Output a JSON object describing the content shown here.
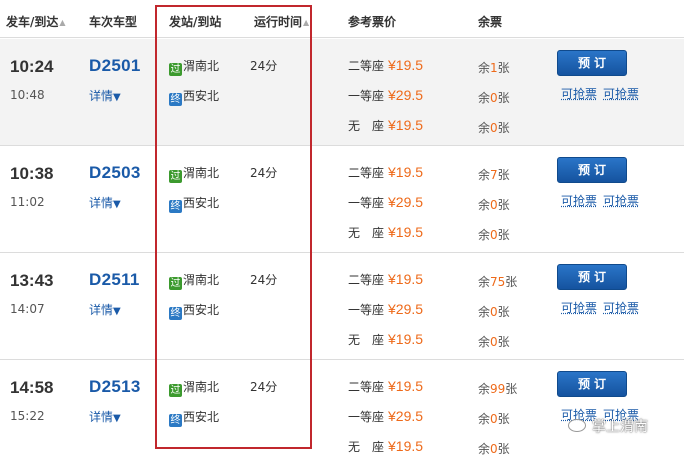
{
  "header": {
    "depart_arrive": "发车/到达",
    "train_type": "车次车型",
    "station": "发站/到站",
    "duration": "运行时间",
    "price": "参考票价",
    "remaining": "余票"
  },
  "labels": {
    "detail": "详情",
    "book": "预订",
    "grab": "可抢票",
    "pass_badge": "过",
    "end_badge": "终"
  },
  "rows": [
    {
      "depart": "10:24",
      "arrive": "10:48",
      "train": "D2501",
      "from": "渭南北",
      "to": "西安北",
      "duration": "24分",
      "seats": [
        {
          "name": "二等座",
          "price": "¥19.5",
          "remain_pre": "余",
          "remain_num": "1",
          "remain_suf": "张"
        },
        {
          "name": "一等座",
          "price": "¥29.5",
          "remain_pre": "余",
          "remain_num": "0",
          "remain_suf": "张"
        },
        {
          "name": "无　座",
          "price": "¥19.5",
          "remain_pre": "余",
          "remain_num": "0",
          "remain_suf": "张"
        }
      ]
    },
    {
      "depart": "10:38",
      "arrive": "11:02",
      "train": "D2503",
      "from": "渭南北",
      "to": "西安北",
      "duration": "24分",
      "seats": [
        {
          "name": "二等座",
          "price": "¥19.5",
          "remain_pre": "余",
          "remain_num": "7",
          "remain_suf": "张"
        },
        {
          "name": "一等座",
          "price": "¥29.5",
          "remain_pre": "余",
          "remain_num": "0",
          "remain_suf": "张"
        },
        {
          "name": "无　座",
          "price": "¥19.5",
          "remain_pre": "余",
          "remain_num": "0",
          "remain_suf": "张"
        }
      ]
    },
    {
      "depart": "13:43",
      "arrive": "14:07",
      "train": "D2511",
      "from": "渭南北",
      "to": "西安北",
      "duration": "24分",
      "seats": [
        {
          "name": "二等座",
          "price": "¥19.5",
          "remain_pre": "余",
          "remain_num": "75",
          "remain_suf": "张"
        },
        {
          "name": "一等座",
          "price": "¥29.5",
          "remain_pre": "余",
          "remain_num": "0",
          "remain_suf": "张"
        },
        {
          "name": "无　座",
          "price": "¥19.5",
          "remain_pre": "余",
          "remain_num": "0",
          "remain_suf": "张"
        }
      ]
    },
    {
      "depart": "14:58",
      "arrive": "15:22",
      "train": "D2513",
      "from": "渭南北",
      "to": "西安北",
      "duration": "24分",
      "seats": [
        {
          "name": "二等座",
          "price": "¥19.5",
          "remain_pre": "余",
          "remain_num": "99",
          "remain_suf": "张"
        },
        {
          "name": "一等座",
          "price": "¥29.5",
          "remain_pre": "余",
          "remain_num": "0",
          "remain_suf": "张"
        },
        {
          "name": "无　座",
          "price": "¥19.5",
          "remain_pre": "余",
          "remain_num": "0",
          "remain_suf": "张"
        }
      ]
    }
  ],
  "watermark": "掌上渭南",
  "colors": {
    "train_link": "#1a5aa8",
    "price": "#ee6a1a",
    "highlight_box": "#c1272d",
    "button": "#1f64b5",
    "pass_badge": "#3c9a2e",
    "end_badge": "#2b79c4"
  },
  "icons": {
    "sort": "sort-arrow-icon",
    "detail_toggle": "triangle-down-icon",
    "pass_station": "pass-station-badge-icon",
    "terminal_station": "terminal-station-badge-icon",
    "watermark": "wechat-logo-icon"
  }
}
